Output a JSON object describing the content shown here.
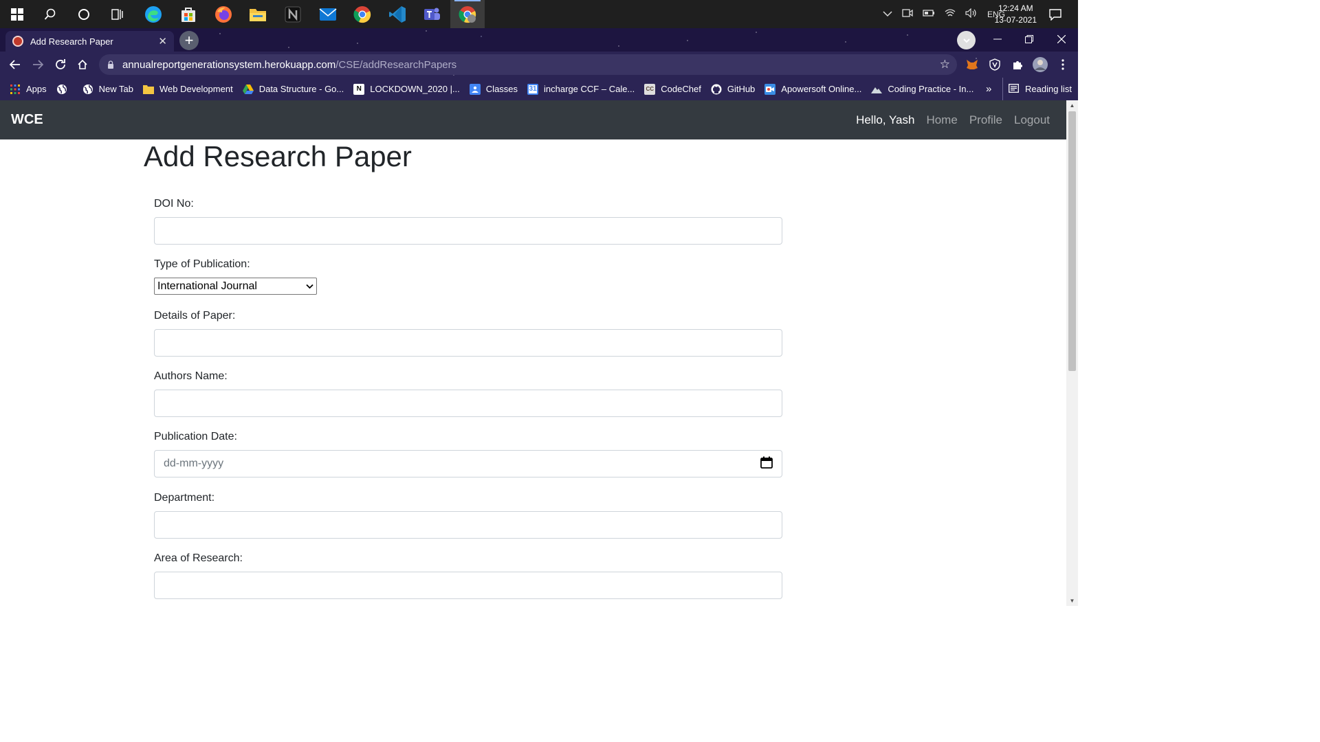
{
  "taskbar": {
    "clock_time": "12:24 AM",
    "clock_date": "13-07-2021",
    "language": "ENG"
  },
  "browser": {
    "tab_title": "Add Research Paper",
    "url_domain": "annualreportgenerationsystem.herokuapp.com",
    "url_path": "/CSE/addResearchPapers",
    "bookmarks": [
      {
        "label": "Apps",
        "icon": "apps-grid-icon",
        "color": "#ea4335"
      },
      {
        "label": "",
        "icon": "globe-icon",
        "color": "#ffffff"
      },
      {
        "label": "New Tab",
        "icon": "globe-icon",
        "color": "#ffffff"
      },
      {
        "label": "Web Development",
        "icon": "folder-icon",
        "color": "#f4c542"
      },
      {
        "label": "Data Structure - Go...",
        "icon": "google-drive-icon",
        "color": "#34a853"
      },
      {
        "label": "LOCKDOWN_2020 |...",
        "icon": "notion-icon",
        "color": "#ffffff"
      },
      {
        "label": "Classes",
        "icon": "classroom-icon",
        "color": "#4285f4"
      },
      {
        "label": "incharge CCF – Cale...",
        "icon": "calendar-icon",
        "color": "#4285f4"
      },
      {
        "label": "CodeChef",
        "icon": "codechef-icon",
        "color": "#dddddd"
      },
      {
        "label": "GitHub",
        "icon": "github-icon",
        "color": "#ffffff"
      },
      {
        "label": "Apowersoft Online...",
        "icon": "apowersoft-icon",
        "color": "#3a8ee6"
      },
      {
        "label": "Coding Practice - In...",
        "icon": "mountain-icon",
        "color": "#cfd8dc"
      }
    ],
    "more_bookmarks": "»",
    "reading_list": "Reading list"
  },
  "navbar": {
    "brand": "WCE",
    "greeting": "Hello, Yash",
    "links": [
      "Home",
      "Profile",
      "Logout"
    ]
  },
  "form": {
    "title": "Add Research Paper",
    "doi_label": "DOI No:",
    "doi_value": "",
    "pub_type_label": "Type of Publication:",
    "pub_type_selected": "International Journal",
    "details_label": "Details of Paper:",
    "details_value": "",
    "authors_label": "Authors Name:",
    "authors_value": "",
    "date_label": "Publication Date:",
    "date_placeholder": "dd-mm-yyyy",
    "department_label": "Department:",
    "department_value": "",
    "area_label": "Area of Research:",
    "area_value": ""
  },
  "colors": {
    "navbar_bg": "#343a40",
    "browser_frame": "#2b2454",
    "taskbar_bg": "#1f1f1f"
  }
}
